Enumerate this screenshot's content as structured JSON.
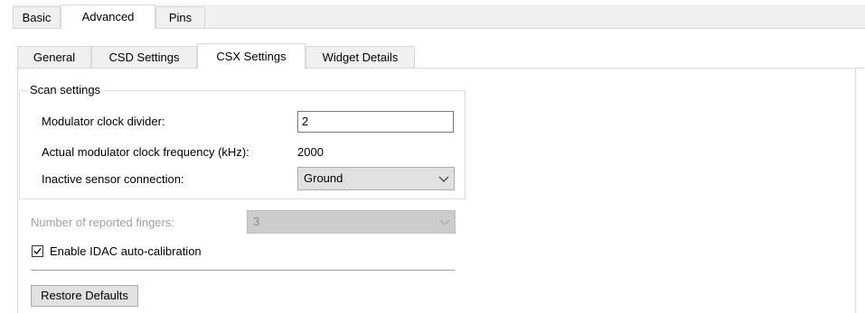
{
  "top_tabs": [
    {
      "label": "Basic",
      "active": false
    },
    {
      "label": "Advanced",
      "active": true
    },
    {
      "label": "Pins",
      "active": false
    }
  ],
  "sub_tabs": [
    {
      "label": "General",
      "active": false
    },
    {
      "label": "CSD Settings",
      "active": false
    },
    {
      "label": "CSX Settings",
      "active": true
    },
    {
      "label": "Widget Details",
      "active": false
    }
  ],
  "scan_settings": {
    "title": "Scan settings",
    "modulator_divider_label": "Modulator clock divider:",
    "modulator_divider_value": "2",
    "actual_freq_label": "Actual modulator clock frequency (kHz):",
    "actual_freq_value": "2000",
    "inactive_sensor_label": "Inactive sensor connection:",
    "inactive_sensor_value": "Ground"
  },
  "fingers": {
    "label": "Number of reported fingers:",
    "value": "3",
    "enabled": false
  },
  "idac": {
    "label": "Enable IDAC auto-calibration",
    "checked": true
  },
  "restore_button": "Restore Defaults",
  "icons": {
    "dropdown": "chevron-down-icon",
    "check": "checkmark-icon"
  },
  "colors": {
    "tab_inactive": "#f0f0f0",
    "border": "#d9d9d9",
    "disabled_text": "#a0a0a0",
    "button_face": "#e1e1e1"
  }
}
